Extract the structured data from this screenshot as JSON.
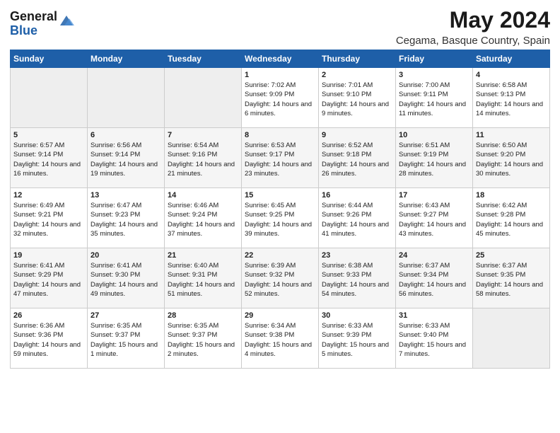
{
  "logo": {
    "general": "General",
    "blue": "Blue"
  },
  "title": "May 2024",
  "subtitle": "Cegama, Basque Country, Spain",
  "days_of_week": [
    "Sunday",
    "Monday",
    "Tuesday",
    "Wednesday",
    "Thursday",
    "Friday",
    "Saturday"
  ],
  "weeks": [
    [
      {
        "day": "",
        "empty": true
      },
      {
        "day": "",
        "empty": true
      },
      {
        "day": "",
        "empty": true
      },
      {
        "day": "1",
        "sunrise": "Sunrise: 7:02 AM",
        "sunset": "Sunset: 9:09 PM",
        "daylight": "Daylight: 14 hours and 6 minutes."
      },
      {
        "day": "2",
        "sunrise": "Sunrise: 7:01 AM",
        "sunset": "Sunset: 9:10 PM",
        "daylight": "Daylight: 14 hours and 9 minutes."
      },
      {
        "day": "3",
        "sunrise": "Sunrise: 7:00 AM",
        "sunset": "Sunset: 9:11 PM",
        "daylight": "Daylight: 14 hours and 11 minutes."
      },
      {
        "day": "4",
        "sunrise": "Sunrise: 6:58 AM",
        "sunset": "Sunset: 9:13 PM",
        "daylight": "Daylight: 14 hours and 14 minutes."
      }
    ],
    [
      {
        "day": "5",
        "sunrise": "Sunrise: 6:57 AM",
        "sunset": "Sunset: 9:14 PM",
        "daylight": "Daylight: 14 hours and 16 minutes."
      },
      {
        "day": "6",
        "sunrise": "Sunrise: 6:56 AM",
        "sunset": "Sunset: 9:14 PM",
        "daylight": "Daylight: 14 hours and 19 minutes."
      },
      {
        "day": "7",
        "sunrise": "Sunrise: 6:54 AM",
        "sunset": "Sunset: 9:16 PM",
        "daylight": "Daylight: 14 hours and 21 minutes."
      },
      {
        "day": "8",
        "sunrise": "Sunrise: 6:53 AM",
        "sunset": "Sunset: 9:17 PM",
        "daylight": "Daylight: 14 hours and 23 minutes."
      },
      {
        "day": "9",
        "sunrise": "Sunrise: 6:52 AM",
        "sunset": "Sunset: 9:18 PM",
        "daylight": "Daylight: 14 hours and 26 minutes."
      },
      {
        "day": "10",
        "sunrise": "Sunrise: 6:51 AM",
        "sunset": "Sunset: 9:19 PM",
        "daylight": "Daylight: 14 hours and 28 minutes."
      },
      {
        "day": "11",
        "sunrise": "Sunrise: 6:50 AM",
        "sunset": "Sunset: 9:20 PM",
        "daylight": "Daylight: 14 hours and 30 minutes."
      }
    ],
    [
      {
        "day": "12",
        "sunrise": "Sunrise: 6:49 AM",
        "sunset": "Sunset: 9:21 PM",
        "daylight": "Daylight: 14 hours and 32 minutes."
      },
      {
        "day": "13",
        "sunrise": "Sunrise: 6:47 AM",
        "sunset": "Sunset: 9:23 PM",
        "daylight": "Daylight: 14 hours and 35 minutes."
      },
      {
        "day": "14",
        "sunrise": "Sunrise: 6:46 AM",
        "sunset": "Sunset: 9:24 PM",
        "daylight": "Daylight: 14 hours and 37 minutes."
      },
      {
        "day": "15",
        "sunrise": "Sunrise: 6:45 AM",
        "sunset": "Sunset: 9:25 PM",
        "daylight": "Daylight: 14 hours and 39 minutes."
      },
      {
        "day": "16",
        "sunrise": "Sunrise: 6:44 AM",
        "sunset": "Sunset: 9:26 PM",
        "daylight": "Daylight: 14 hours and 41 minutes."
      },
      {
        "day": "17",
        "sunrise": "Sunrise: 6:43 AM",
        "sunset": "Sunset: 9:27 PM",
        "daylight": "Daylight: 14 hours and 43 minutes."
      },
      {
        "day": "18",
        "sunrise": "Sunrise: 6:42 AM",
        "sunset": "Sunset: 9:28 PM",
        "daylight": "Daylight: 14 hours and 45 minutes."
      }
    ],
    [
      {
        "day": "19",
        "sunrise": "Sunrise: 6:41 AM",
        "sunset": "Sunset: 9:29 PM",
        "daylight": "Daylight: 14 hours and 47 minutes."
      },
      {
        "day": "20",
        "sunrise": "Sunrise: 6:41 AM",
        "sunset": "Sunset: 9:30 PM",
        "daylight": "Daylight: 14 hours and 49 minutes."
      },
      {
        "day": "21",
        "sunrise": "Sunrise: 6:40 AM",
        "sunset": "Sunset: 9:31 PM",
        "daylight": "Daylight: 14 hours and 51 minutes."
      },
      {
        "day": "22",
        "sunrise": "Sunrise: 6:39 AM",
        "sunset": "Sunset: 9:32 PM",
        "daylight": "Daylight: 14 hours and 52 minutes."
      },
      {
        "day": "23",
        "sunrise": "Sunrise: 6:38 AM",
        "sunset": "Sunset: 9:33 PM",
        "daylight": "Daylight: 14 hours and 54 minutes."
      },
      {
        "day": "24",
        "sunrise": "Sunrise: 6:37 AM",
        "sunset": "Sunset: 9:34 PM",
        "daylight": "Daylight: 14 hours and 56 minutes."
      },
      {
        "day": "25",
        "sunrise": "Sunrise: 6:37 AM",
        "sunset": "Sunset: 9:35 PM",
        "daylight": "Daylight: 14 hours and 58 minutes."
      }
    ],
    [
      {
        "day": "26",
        "sunrise": "Sunrise: 6:36 AM",
        "sunset": "Sunset: 9:36 PM",
        "daylight": "Daylight: 14 hours and 59 minutes."
      },
      {
        "day": "27",
        "sunrise": "Sunrise: 6:35 AM",
        "sunset": "Sunset: 9:37 PM",
        "daylight": "Daylight: 15 hours and 1 minute."
      },
      {
        "day": "28",
        "sunrise": "Sunrise: 6:35 AM",
        "sunset": "Sunset: 9:37 PM",
        "daylight": "Daylight: 15 hours and 2 minutes."
      },
      {
        "day": "29",
        "sunrise": "Sunrise: 6:34 AM",
        "sunset": "Sunset: 9:38 PM",
        "daylight": "Daylight: 15 hours and 4 minutes."
      },
      {
        "day": "30",
        "sunrise": "Sunrise: 6:33 AM",
        "sunset": "Sunset: 9:39 PM",
        "daylight": "Daylight: 15 hours and 5 minutes."
      },
      {
        "day": "31",
        "sunrise": "Sunrise: 6:33 AM",
        "sunset": "Sunset: 9:40 PM",
        "daylight": "Daylight: 15 hours and 7 minutes."
      },
      {
        "day": "",
        "empty": true
      }
    ]
  ]
}
